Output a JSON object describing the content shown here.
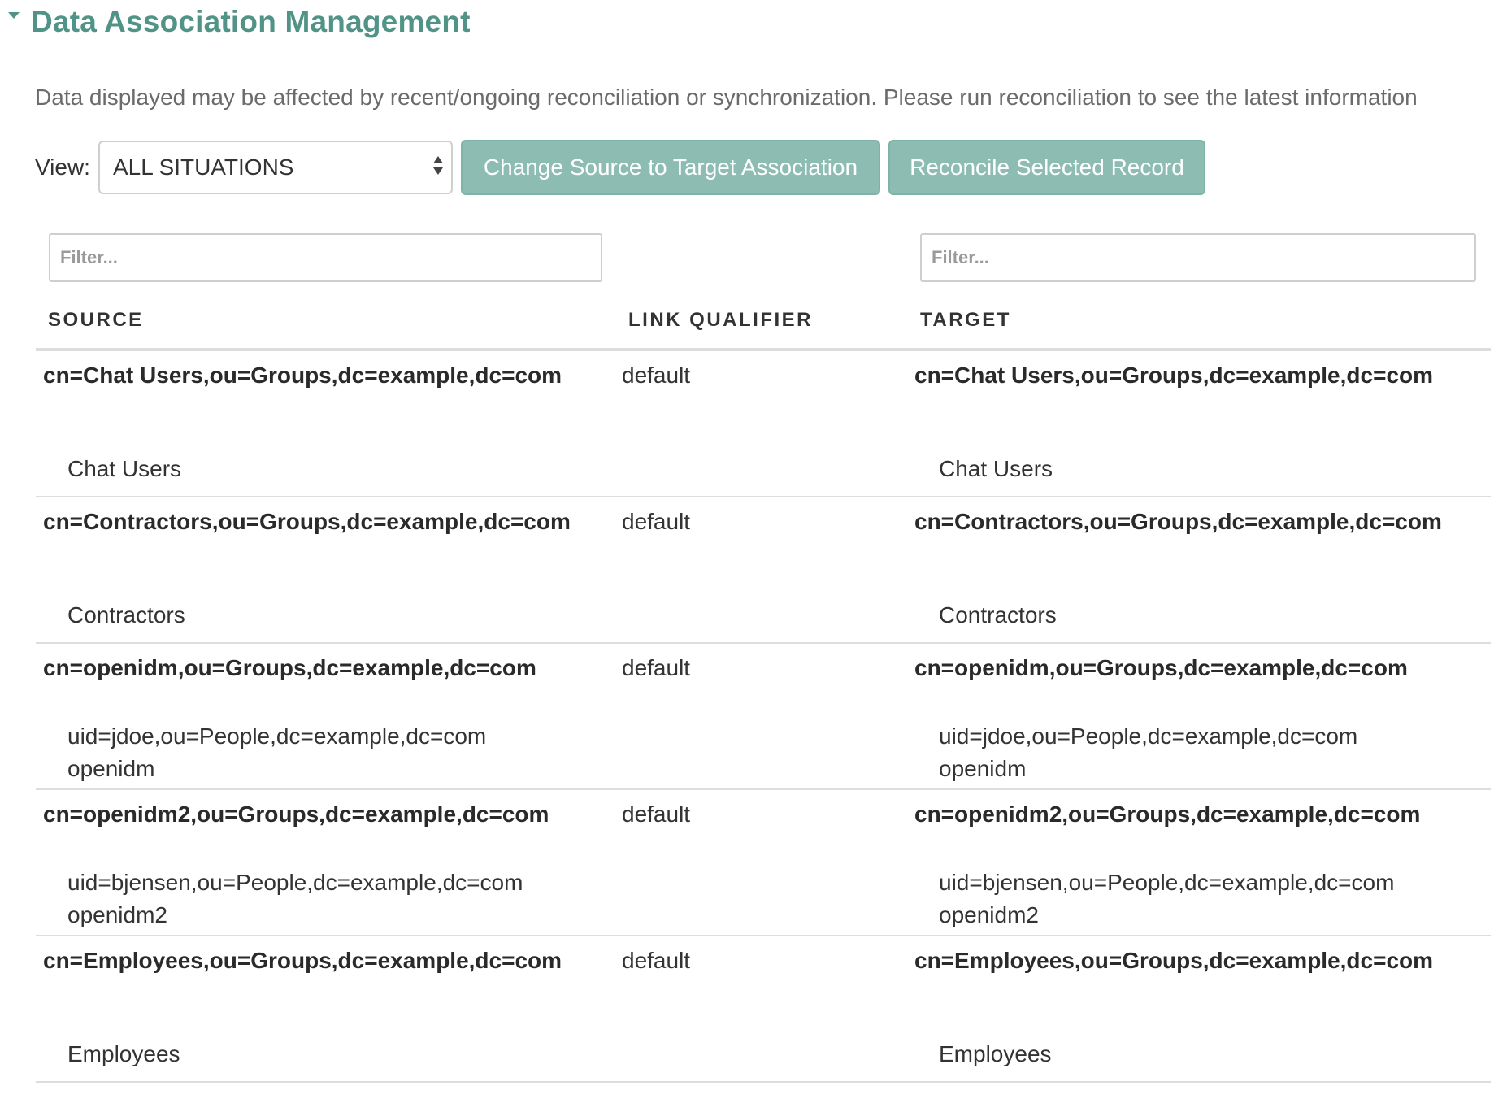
{
  "header": {
    "title": "Data Association Management"
  },
  "notice": "Data displayed may be affected by recent/ongoing reconciliation or synchronization. Please run reconciliation to see the latest information",
  "toolbar": {
    "view_label": "View:",
    "view_selected": "ALL SITUATIONS",
    "change_button": "Change Source to Target Association",
    "reconcile_button": "Reconcile Selected Record"
  },
  "filters": {
    "source_placeholder": "Filter...",
    "target_placeholder": "Filter..."
  },
  "columns": {
    "source": "SOURCE",
    "link_qualifier": "LINK QUALIFIER",
    "target": "TARGET"
  },
  "rows": [
    {
      "source_dn": "cn=Chat Users,ou=Groups,dc=example,dc=com",
      "source_details": [
        "Chat Users"
      ],
      "link_qualifier": "default",
      "target_dn": "cn=Chat Users,ou=Groups,dc=example,dc=com",
      "target_details": [
        "Chat Users"
      ]
    },
    {
      "source_dn": "cn=Contractors,ou=Groups,dc=example,dc=com",
      "source_details": [
        "Contractors"
      ],
      "link_qualifier": "default",
      "target_dn": "cn=Contractors,ou=Groups,dc=example,dc=com",
      "target_details": [
        "Contractors"
      ]
    },
    {
      "source_dn": "cn=openidm,ou=Groups,dc=example,dc=com",
      "source_details": [
        "uid=jdoe,ou=People,dc=example,dc=com",
        "openidm"
      ],
      "link_qualifier": "default",
      "target_dn": "cn=openidm,ou=Groups,dc=example,dc=com",
      "target_details": [
        "uid=jdoe,ou=People,dc=example,dc=com",
        "openidm"
      ]
    },
    {
      "source_dn": "cn=openidm2,ou=Groups,dc=example,dc=com",
      "source_details": [
        "uid=bjensen,ou=People,dc=example,dc=com",
        "openidm2"
      ],
      "link_qualifier": "default",
      "target_dn": "cn=openidm2,ou=Groups,dc=example,dc=com",
      "target_details": [
        "uid=bjensen,ou=People,dc=example,dc=com",
        "openidm2"
      ]
    },
    {
      "source_dn": "cn=Employees,ou=Groups,dc=example,dc=com",
      "source_details": [
        "Employees"
      ],
      "link_qualifier": "default",
      "target_dn": "cn=Employees,ou=Groups,dc=example,dc=com",
      "target_details": [
        "Employees"
      ]
    }
  ]
}
